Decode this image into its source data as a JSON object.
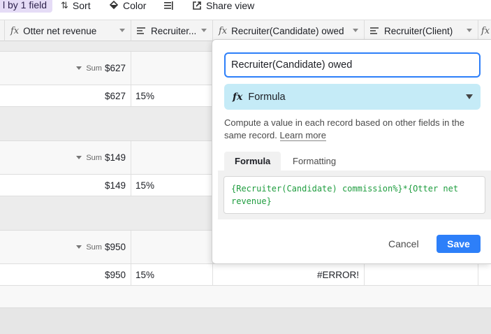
{
  "toolbar": {
    "group_label": "l by 1 field",
    "sort_label": "Sort",
    "color_label": "Color",
    "share_label": "Share view"
  },
  "columns": [
    {
      "name": "Otter net revenue",
      "icon": "formula-icon"
    },
    {
      "name": "Recruiter...",
      "icon": "lookup-icon"
    },
    {
      "name": "Recruiter(Candidate) owed",
      "icon": "formula-icon"
    },
    {
      "name": "Recruiter(Client)",
      "icon": "lookup-icon"
    }
  ],
  "groups": [
    {
      "sum_label": "Sum",
      "sum_value": "$627",
      "row": {
        "revenue": "$627",
        "pct": "15%",
        "owed": ""
      }
    },
    {
      "sum_label": "Sum",
      "sum_value": "$149",
      "row": {
        "revenue": "$149",
        "pct": "15%",
        "owed": ""
      }
    },
    {
      "sum_label": "Sum",
      "sum_value": "$950",
      "row": {
        "revenue": "$950",
        "pct": "15%",
        "owed": "#ERROR!"
      }
    }
  ],
  "field_editor": {
    "name_value": "Recruiter(Candidate) owed",
    "type_label": "Formula",
    "description": "Compute a value in each record based on other fields in the same record.",
    "learn_more": "Learn more",
    "tabs": [
      "Formula",
      "Formatting"
    ],
    "formula": "{Recruiter(Candidate) commission%}*{Otter net revenue}",
    "cancel_label": "Cancel",
    "save_label": "Save"
  },
  "colors": {
    "accent": "#2d7ff9",
    "type_bg": "#c5ebf7",
    "formula_text": "#1f9d3f",
    "group_badge": "#e5dcf6"
  }
}
